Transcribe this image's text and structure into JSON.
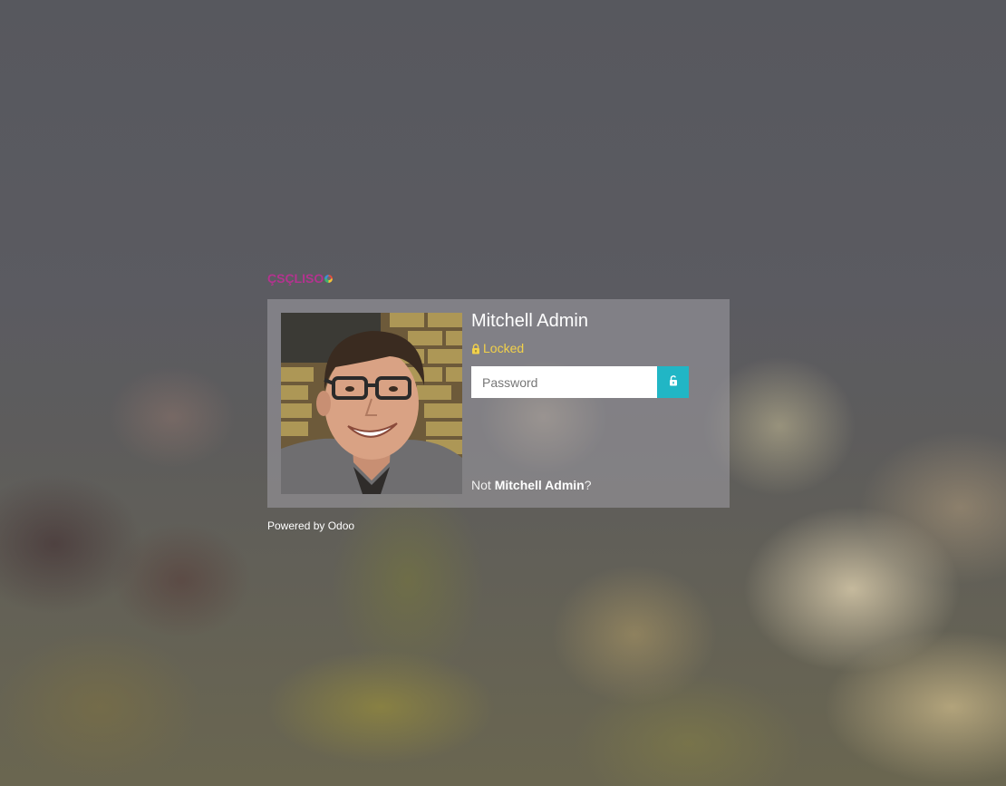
{
  "brand": {
    "logo_text": "ÇSÇLISO",
    "icon": "odoo-ring-icon"
  },
  "lock_screen": {
    "user_name": "Mitchell Admin",
    "status_label": "Locked",
    "status_icon": "lock-icon",
    "status_color": "#f2d14a",
    "password": {
      "placeholder": "Password",
      "value": ""
    },
    "unlock_button_icon": "unlock-icon",
    "accent_color": "#21b6c5",
    "not_user_prefix": "Not ",
    "not_user_name": "Mitchell Admin",
    "not_user_suffix": "?"
  },
  "footer": {
    "powered_by": "Powered by Odoo"
  }
}
